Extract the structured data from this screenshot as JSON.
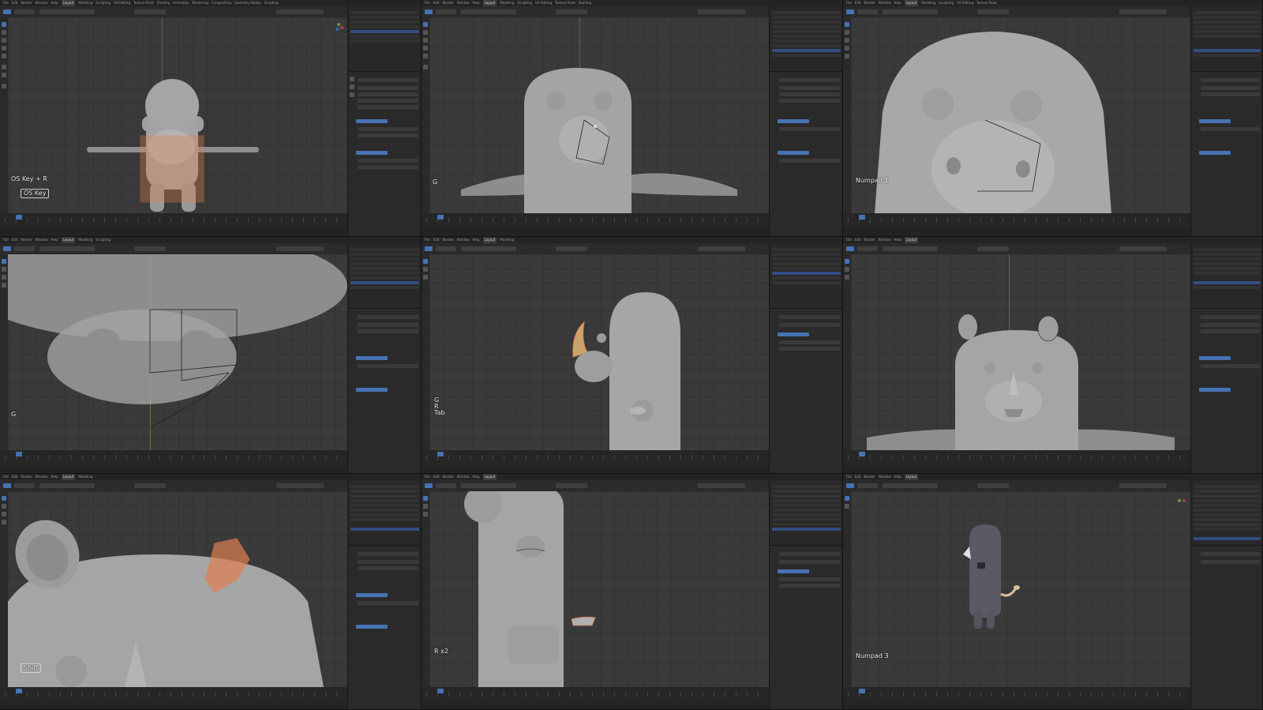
{
  "app": {
    "menus": [
      "File",
      "Edit",
      "Render",
      "Window",
      "Help",
      "Layout",
      "Modeling",
      "Sculpting",
      "UV Editing",
      "Texture Paint",
      "Shading",
      "Animation",
      "Rendering",
      "Compositing",
      "Geometry Nodes",
      "Scripting"
    ],
    "active_workspace": "Layout"
  },
  "tiles": [
    {
      "id": 1,
      "key_hint": "OS Key + R",
      "key_hint_2": "OS Key"
    },
    {
      "id": 2,
      "key_hint": "G"
    },
    {
      "id": 3,
      "key_hint": "Numpad 1"
    },
    {
      "id": 4,
      "key_hint": "G"
    },
    {
      "id": 5,
      "key_hint": "G",
      "key_hint_2": "R",
      "key_hint_3": "Tab"
    },
    {
      "id": 6,
      "key_hint": ""
    },
    {
      "id": 7,
      "key_hint": "Shift"
    },
    {
      "id": 8,
      "key_hint": "R x2"
    },
    {
      "id": 9,
      "key_hint": "Numpad 3"
    }
  ],
  "colors": {
    "selection_orange": "#e08050",
    "active_blue": "#4772b3",
    "model_gray": "#9a9a9a"
  }
}
